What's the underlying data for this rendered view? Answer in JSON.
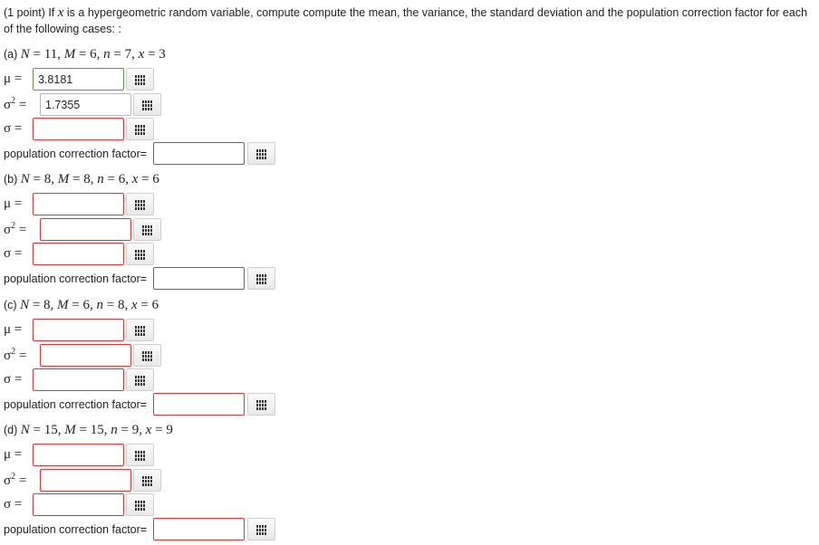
{
  "intro": {
    "prefix": "(1 point) If ",
    "var": "x",
    "text": " is a hypergeometric random variable, compute compute the mean, the variance, the standard deviation and the population correction factor for each of the following cases: :"
  },
  "labels": {
    "mu": "μ =",
    "sigma2_base": "σ",
    "sigma2_sup": "2",
    "sigma2_eq": "=",
    "sigma": "σ =",
    "pcf": "population correction factor="
  },
  "icon": "grid-icon",
  "parts": [
    {
      "letter": "(a)",
      "N": "11",
      "M": "6",
      "n": "7",
      "x": "3",
      "mu_value": "3.8181",
      "sigma2_value": "1.7355",
      "sigma_value": "",
      "pcf_value": ""
    },
    {
      "letter": "(b)",
      "N": "8",
      "M": "8",
      "n": "6",
      "x": "6",
      "mu_value": "",
      "sigma2_value": "",
      "sigma_value": "",
      "pcf_value": ""
    },
    {
      "letter": "(c)",
      "N": "8",
      "M": "6",
      "n": "8",
      "x": "6",
      "mu_value": "",
      "sigma2_value": "",
      "sigma_value": "",
      "pcf_value": ""
    },
    {
      "letter": "(d)",
      "N": "15",
      "M": "15",
      "n": "9",
      "x": "9",
      "mu_value": "",
      "sigma2_value": "",
      "sigma_value": "",
      "pcf_value": ""
    }
  ]
}
